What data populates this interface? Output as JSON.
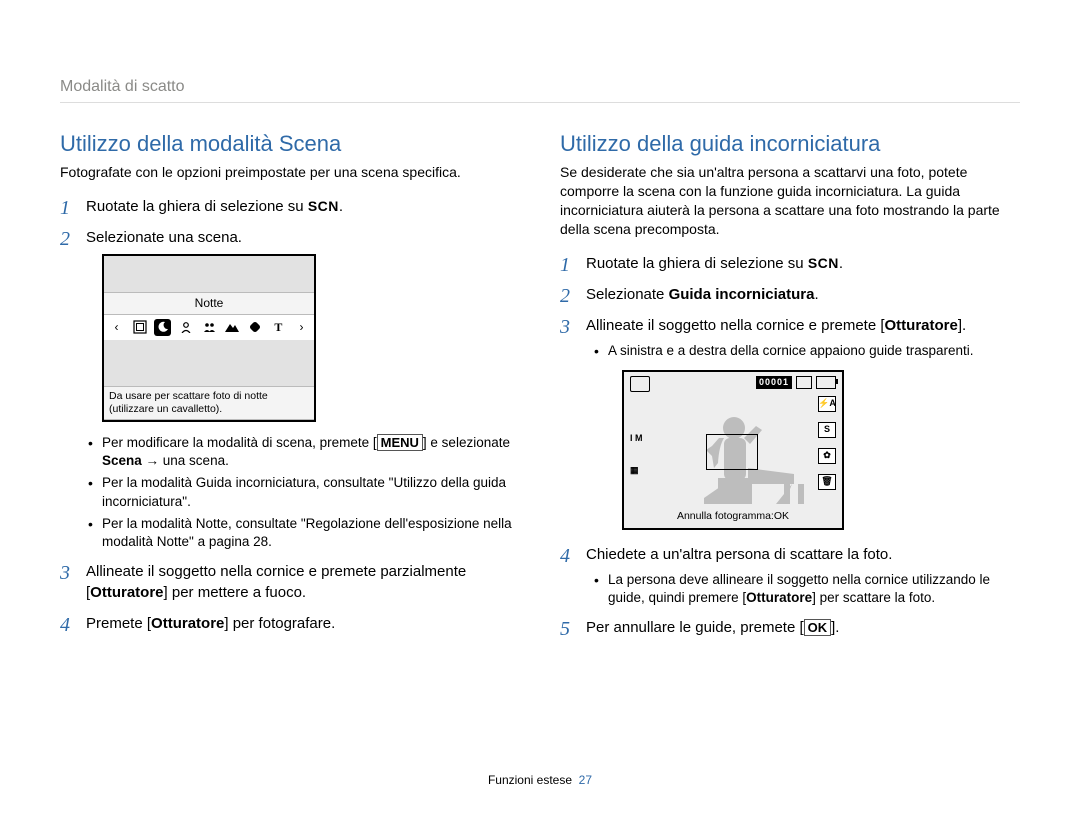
{
  "breadcrumb": "Modalità di scatto",
  "left": {
    "title": "Utilizzo della modalità Scena",
    "intro": "Fotografate con le opzioni preimpostate per una scena specifica.",
    "step1_pre": "Ruotate la ghiera di selezione su ",
    "scn": "SCN",
    "step1_post": ".",
    "step2": "Selezionate una scena.",
    "lcd": {
      "title": "Notte",
      "desc_line1": "Da usare per scattare foto di notte",
      "desc_line2": "(utilizzare un cavalletto)."
    },
    "bullet1_a": "Per modificare la modalità di scena, premete [",
    "bullet1_menu": "MENU",
    "bullet1_b": "] e selezionate ",
    "bullet1_scena": "Scena",
    "bullet1_c": " → una scena.",
    "bullet2": "Per la modalità Guida incorniciatura, consultate \"Utilizzo della guida incorniciatura\".",
    "bullet3": "Per la modalità Notte, consultate \"Regolazione dell'esposizione nella modalità Notte\" a pagina 28.",
    "step3_a": "Allineate il soggetto nella cornice e premete parzialmente [",
    "step3_btn": "Otturatore",
    "step3_b": "] per mettere a fuoco.",
    "step4_a": "Premete [",
    "step4_btn": "Otturatore",
    "step4_b": "] per fotografare."
  },
  "right": {
    "title": "Utilizzo della guida incorniciatura",
    "intro": "Se desiderate che sia un'altra persona a scattarvi una foto, potete comporre la scena con la funzione guida incorniciatura. La guida incorniciatura aiuterà la persona a scattare una foto mostrando la parte della scena precomposta.",
    "step1_pre": "Ruotate la ghiera di selezione su ",
    "scn": "SCN",
    "step1_post": ".",
    "step2_a": "Selezionate ",
    "step2_b": "Guida incorniciatura",
    "step2_c": ".",
    "step3_a": "Allineate il soggetto nella cornice e premete [",
    "step3_btn": "Otturatore",
    "step3_b": "].",
    "step3_sub": "A sinistra e a destra della cornice appaiono guide trasparenti.",
    "lcd": {
      "counter": "00001",
      "auto_s": "S",
      "lm": "I M",
      "caption": "Annulla fotogramma:OK"
    },
    "step4": "Chiedete a un'altra persona di scattare la foto.",
    "step4_sub_a": "La persona deve allineare il soggetto nella cornice utilizzando le guide, quindi premere [",
    "step4_sub_btn": "Otturatore",
    "step4_sub_b": "] per scattare la foto.",
    "step5_a": "Per annullare le guide, premete [",
    "step5_btn": "OK",
    "step5_b": "]."
  },
  "footer": {
    "label": "Funzioni estese",
    "page": "27"
  }
}
